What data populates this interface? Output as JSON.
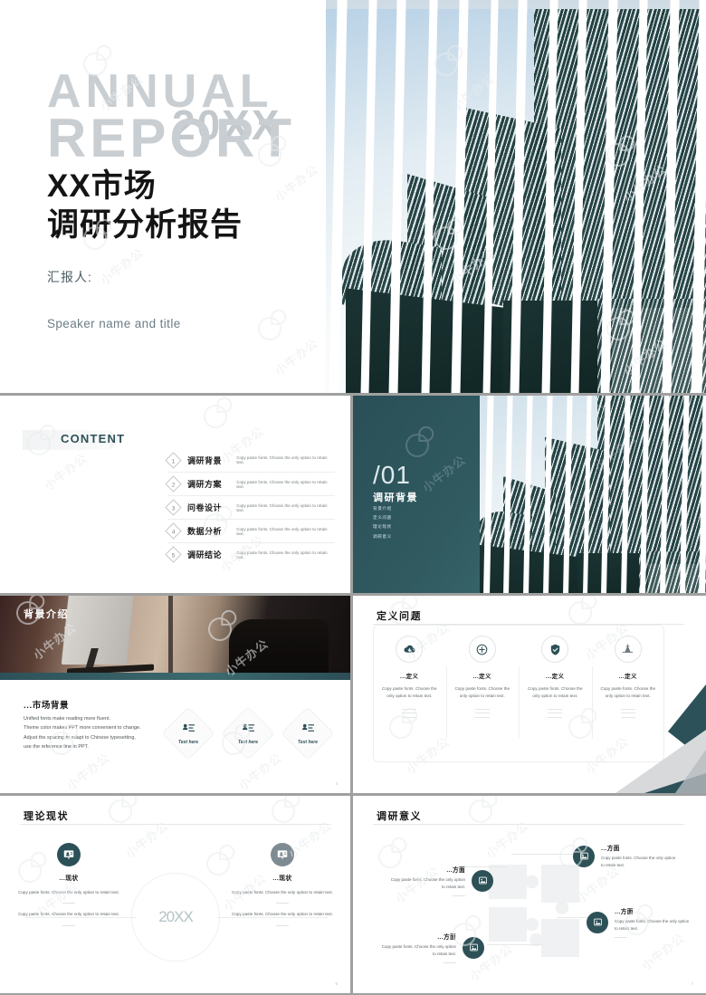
{
  "theme": {
    "accent": "#2d5157",
    "accent_light": "#3a6a6e",
    "ghost_text": "#c9ced2",
    "body_text": "#5f666a"
  },
  "cover": {
    "ghost_line1": "ANNUAL",
    "ghost_line2": "REPORT",
    "ghost_year": "20XX",
    "title_line1": "XX市场",
    "title_line2": "调研分析报告",
    "reporter_label": "汇报人:",
    "speaker": "Speaker name and title"
  },
  "content": {
    "label": "CONTENT",
    "items": [
      {
        "num": "1",
        "cn": "调研背景",
        "en": "Copy paste fonts. Choose the only option to retain text."
      },
      {
        "num": "2",
        "cn": "调研方案",
        "en": "Copy paste fonts. Choose the only option to retain text."
      },
      {
        "num": "3",
        "cn": "问卷设计",
        "en": "Copy paste fonts. Choose the only option to retain text."
      },
      {
        "num": "4",
        "cn": "数据分析",
        "en": "Copy paste fonts. Choose the only option to retain text."
      },
      {
        "num": "5",
        "cn": "调研结论",
        "en": "Copy paste fonts. Choose the only option to retain text."
      }
    ]
  },
  "section": {
    "number": "/01",
    "title": "调研背景",
    "items": [
      "背景介绍",
      "定义问题",
      "理论现状",
      "调研意义"
    ]
  },
  "slide_background": {
    "title": "背景介绍",
    "heading": "...市场背景",
    "body": [
      "Unified fonts make reading more fluent.",
      "Theme color makes PPT more convenient to change.",
      "Adjust the spacing to adapt to Chinese typesetting,",
      "use the reference line in PPT."
    ],
    "diamonds": [
      {
        "icon": "person-list-icon",
        "label": "Text here"
      },
      {
        "icon": "person-list-icon",
        "label": "Text here"
      },
      {
        "icon": "person-list-icon",
        "label": "Text here"
      }
    ],
    "page": "4"
  },
  "slide_define": {
    "title": "定义问题",
    "columns": [
      {
        "icon": "cloud-download-icon",
        "label": "...定义",
        "text": "Copy paste fonts. Choose the only option to retain text."
      },
      {
        "icon": "plus-circle-icon",
        "label": "...定义",
        "text": "Copy paste fonts. Choose the only option to retain text."
      },
      {
        "icon": "shield-check-icon",
        "label": "...定义",
        "text": "Copy paste fonts. Choose the only option to retain text."
      },
      {
        "icon": "mountain-icon",
        "label": "...定义",
        "text": "Copy paste fonts. Choose the only option to retain text."
      }
    ]
  },
  "slide_theory": {
    "title": "理论现状",
    "center_year": "20XX",
    "left": {
      "icon": "presentation-user-icon",
      "label": "...现状",
      "text1": "Copy paste fonts. Choose the only option to retain text.",
      "text2": "Copy paste fonts. Choose the only option to retain text."
    },
    "right": {
      "icon": "presentation-user-icon",
      "label": "...现状",
      "text1": "Copy paste fonts. Choose the only option to retain text.",
      "text2": "Copy paste fonts. Choose the only option to retain text."
    },
    "page": "6"
  },
  "slide_meaning": {
    "title": "调研意义",
    "nodes": [
      {
        "icon": "image-frame-icon",
        "label": "...方面",
        "text": "Copy paste fonts. Choose the only option to retain text."
      },
      {
        "icon": "image-frame-icon",
        "label": "...方面",
        "text": "Copy paste fonts. Choose the only option to retain text."
      },
      {
        "icon": "image-frame-icon",
        "label": "...方面",
        "text": "Copy paste fonts. Choose the only option to retain text."
      },
      {
        "icon": "image-frame-icon",
        "label": "...方面",
        "text": "Copy paste fonts. Choose the only option to retain text."
      }
    ],
    "page": "7"
  }
}
